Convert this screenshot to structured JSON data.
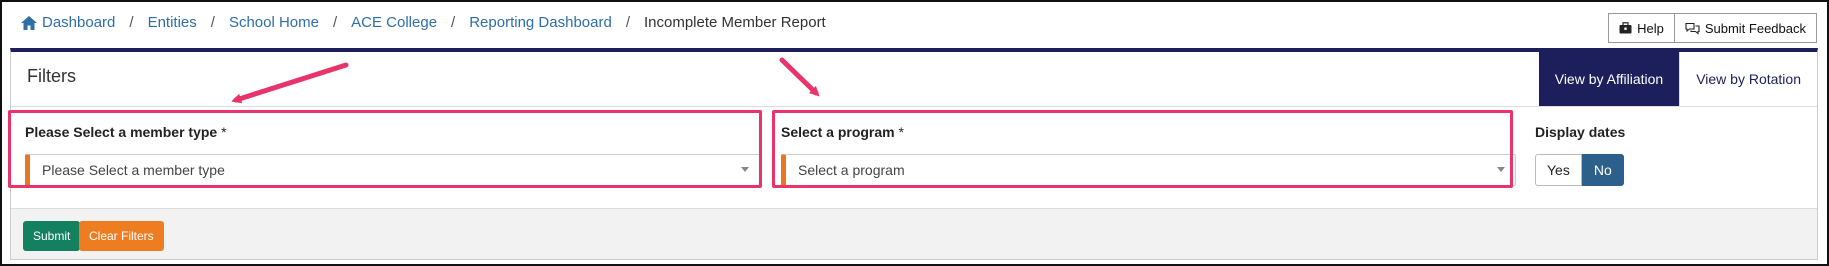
{
  "breadcrumb": {
    "items": [
      "Dashboard",
      "Entities",
      "School Home",
      "ACE College",
      "Reporting Dashboard"
    ],
    "separator": "/",
    "current": "Incomplete Member Report"
  },
  "header_buttons": {
    "help": "Help",
    "feedback": "Submit Feedback"
  },
  "filters": {
    "title": "Filters",
    "tabs": [
      {
        "label": "View by Affiliation",
        "active": true
      },
      {
        "label": "View by Rotation",
        "active": false
      }
    ],
    "member_type": {
      "label": "Please Select a member type",
      "required_mark": "*",
      "placeholder": "Please Select a member type"
    },
    "program": {
      "label": "Select a program",
      "required_mark": "*",
      "placeholder": "Select a program"
    },
    "display_dates": {
      "label": "Display dates",
      "yes": "Yes",
      "no": "No",
      "selected": "No"
    }
  },
  "actions": {
    "submit": "Submit",
    "clear": "Clear Filters"
  },
  "colors": {
    "accent": "#1c1f5c",
    "link": "#2f6ea8",
    "required_marker": "#e87722",
    "submit": "#13805f",
    "clear": "#ee7d22",
    "toggle_active": "#2c5f8a",
    "annotation": "#e8336b"
  },
  "icons": {
    "home": "home-icon",
    "help": "briefcase-icon",
    "feedback": "chat-bubbles-icon",
    "dropdown": "caret-down-icon"
  }
}
